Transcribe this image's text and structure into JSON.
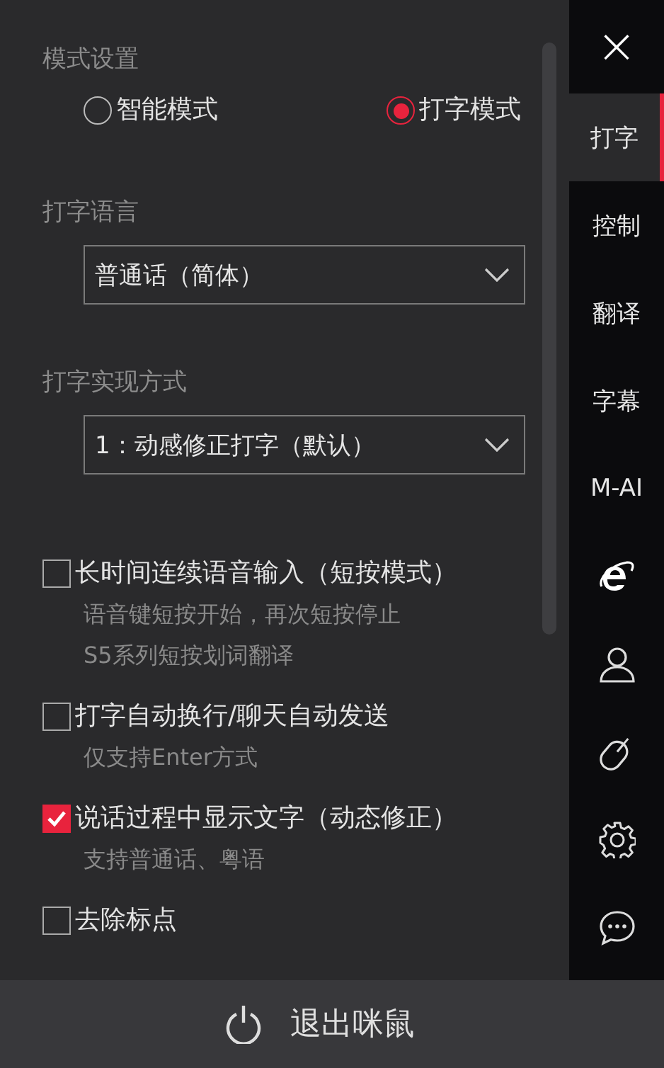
{
  "mode_settings": {
    "heading": "模式设置",
    "options": [
      {
        "label": "智能模式",
        "selected": false
      },
      {
        "label": "打字模式",
        "selected": true
      }
    ]
  },
  "language": {
    "heading": "打字语言",
    "value": "普通话（简体）"
  },
  "method": {
    "heading": "打字实现方式",
    "value": "1：动感修正打字（默认）"
  },
  "options": [
    {
      "label": "长时间连续语音输入（短按模式）",
      "checked": false,
      "hints": [
        "语音键短按开始，再次短按停止",
        "S5系列短按划词翻译"
      ]
    },
    {
      "label": "打字自动换行/聊天自动发送",
      "checked": false,
      "hints": [
        "仅支持Enter方式"
      ]
    },
    {
      "label": "说话过程中显示文字（动态修正）",
      "checked": true,
      "hints": [
        "支持普通话、粤语"
      ]
    },
    {
      "label": "去除标点",
      "checked": false
    }
  ],
  "sidebar": {
    "close": "×",
    "tabs": [
      {
        "label": "打字",
        "selected": true
      },
      {
        "label": "控制",
        "selected": false
      },
      {
        "label": "翻译",
        "selected": false
      },
      {
        "label": "字幕",
        "selected": false
      },
      {
        "label": "M-AI",
        "selected": false
      }
    ]
  },
  "footer": {
    "exit": "退出咪鼠"
  }
}
